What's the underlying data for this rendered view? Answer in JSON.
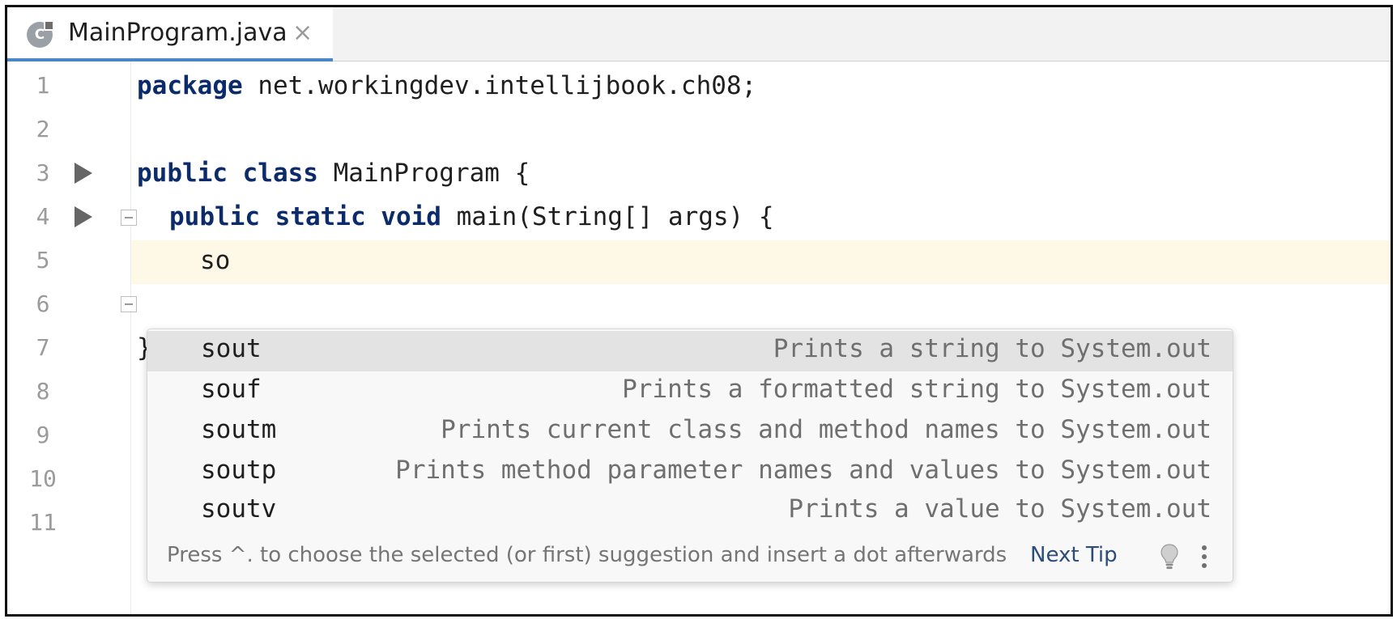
{
  "tab": {
    "icon_letter": "C",
    "title": "MainProgram.java",
    "close_glyph": "×"
  },
  "editor": {
    "line_numbers": [
      "1",
      "2",
      "3",
      "4",
      "5",
      "6",
      "7",
      "8",
      "9",
      "10",
      "11"
    ],
    "code": {
      "line1": {
        "kw": "package",
        "rest": " net.workingdev.intellijbook.ch08;"
      },
      "line3": {
        "kw": "public class",
        "rest": " MainProgram {"
      },
      "line4": {
        "kw": "public static void",
        "rest": " main(String[] args) {"
      },
      "line5": {
        "text": "so"
      },
      "line7": {
        "text": "}"
      }
    }
  },
  "completion": {
    "items": [
      {
        "name": "sout",
        "desc": "Prints a string to System.out",
        "selected": true
      },
      {
        "name": "souf",
        "desc": "Prints a formatted string to System.out",
        "selected": false
      },
      {
        "name": "soutm",
        "desc": "Prints current class and method names to System.out",
        "selected": false
      },
      {
        "name": "soutp",
        "desc": "Prints method parameter names and values to System.out",
        "selected": false
      },
      {
        "name": "soutv",
        "desc": "Prints a value to System.out",
        "selected": false
      }
    ],
    "footer_hint": "Press ^. to choose the selected (or first) suggestion and insert a dot afterwards",
    "next_tip": "Next Tip"
  },
  "colors": {
    "keyword": "#0b2b6b",
    "current_line": "#fdf9e6",
    "tab_underline": "#4a86c8"
  }
}
